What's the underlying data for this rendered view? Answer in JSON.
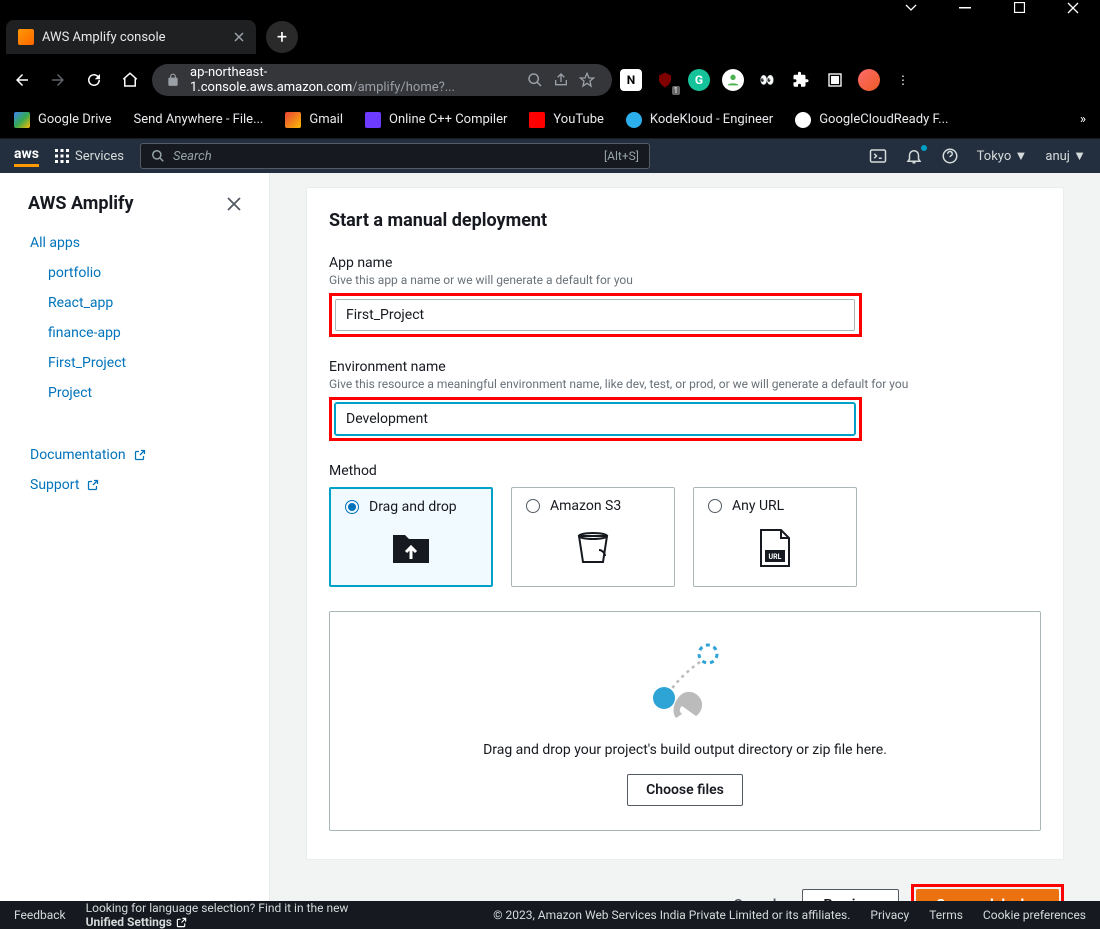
{
  "window": {
    "title": "AWS Amplify console"
  },
  "url": {
    "host": "ap-northeast-1.console.aws.amazon.com",
    "path": "/amplify/home?..."
  },
  "bookmarks": [
    {
      "label": "Google Drive"
    },
    {
      "label": "Send Anywhere - File..."
    },
    {
      "label": "Gmail"
    },
    {
      "label": "Online C++ Compiler"
    },
    {
      "label": "YouTube"
    },
    {
      "label": "KodeKloud - Engineer"
    },
    {
      "label": "GoogleCloudReady F..."
    }
  ],
  "aws": {
    "services": "Services",
    "search_placeholder": "Search",
    "search_kbd": "[Alt+S]",
    "region": "Tokyo",
    "user": "anuj"
  },
  "sidebar": {
    "title": "AWS Amplify",
    "all_apps": "All apps",
    "items": [
      {
        "label": "portfolio"
      },
      {
        "label": "React_app"
      },
      {
        "label": "finance-app"
      },
      {
        "label": "First_Project"
      },
      {
        "label": "Project"
      }
    ],
    "docs": "Documentation",
    "support": "Support"
  },
  "page": {
    "title": "Start a manual deployment",
    "app_name": {
      "label": "App name",
      "hint": "Give this app a name or we will generate a default for you",
      "value": "First_Project"
    },
    "env": {
      "label": "Environment name",
      "hint": "Give this resource a meaningful environment name, like dev, test, or prod, or we will generate a default for you",
      "value": "Development"
    },
    "method": {
      "label": "Method",
      "options": [
        "Drag and drop",
        "Amazon S3",
        "Any URL"
      ]
    },
    "drop": {
      "text": "Drag and drop your project's build output directory or zip file here.",
      "button": "Choose files"
    },
    "actions": {
      "cancel": "Cancel",
      "prev": "Previous",
      "save": "Save and deploy"
    }
  },
  "footer": {
    "feedback": "Feedback",
    "lang": "Looking for language selection? Find it in the new",
    "unified": "Unified Settings",
    "copyright": "© 2023, Amazon Web Services India Private Limited or its affiliates.",
    "privacy": "Privacy",
    "terms": "Terms",
    "cookies": "Cookie preferences"
  }
}
